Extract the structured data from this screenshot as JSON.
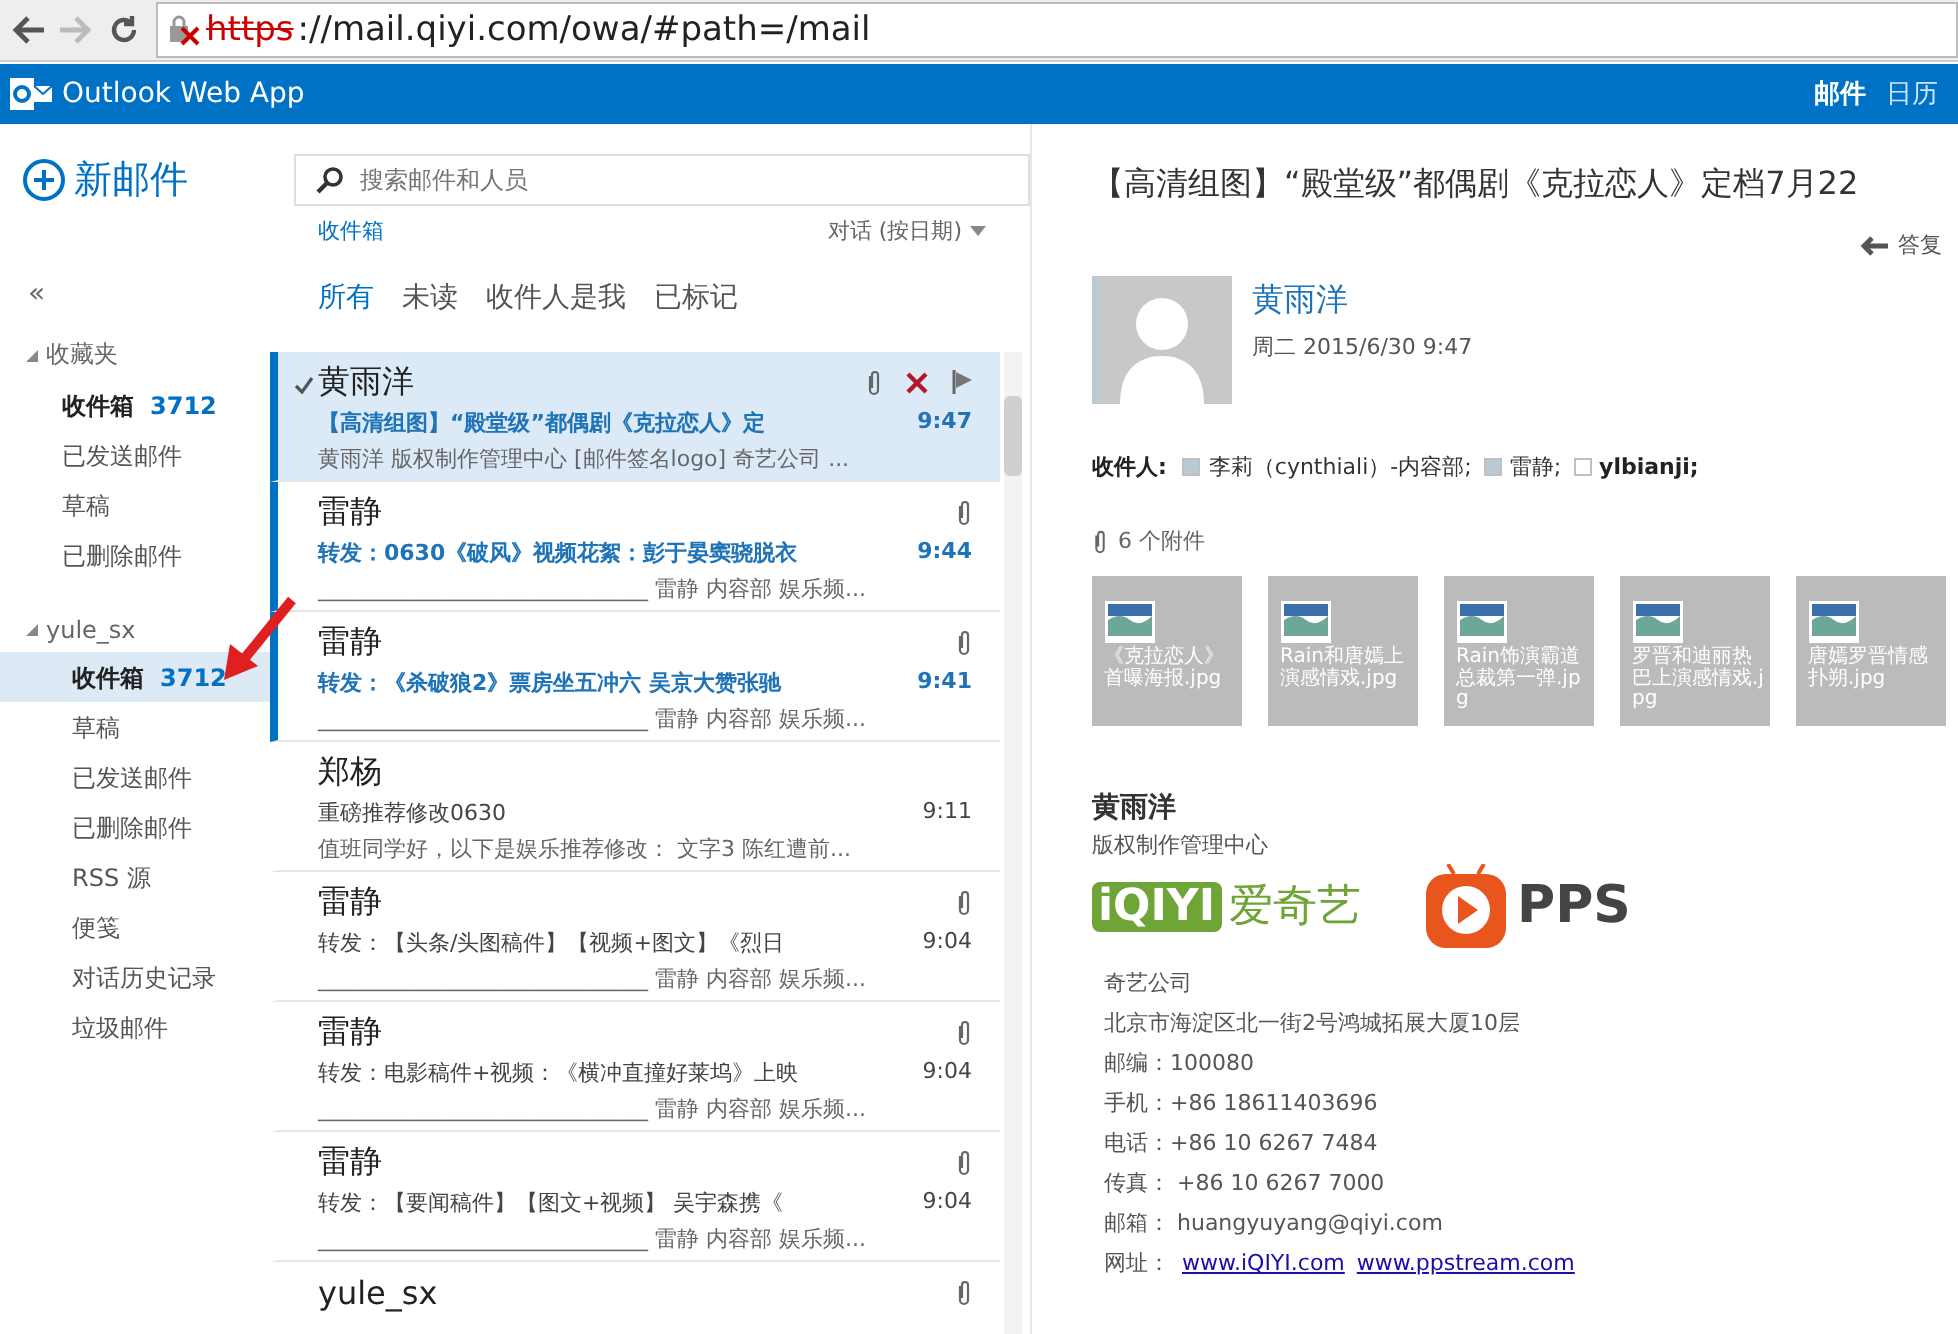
{
  "browser": {
    "url_scheme": "https",
    "url_rest": "://mail.qiyi.com/owa/#path=/mail"
  },
  "app_bar": {
    "title": "Outlook Web App",
    "nav": [
      {
        "label": "邮件",
        "selected": true
      },
      {
        "label": "日历",
        "selected": false
      }
    ]
  },
  "sidebar": {
    "new_mail": "新邮件",
    "collapse": "«",
    "groups": [
      {
        "name": "收藏夹",
        "expanded": true,
        "items": [
          {
            "label": "收件箱",
            "count": "3712",
            "selected": false
          },
          {
            "label": "已发送邮件",
            "selected": false
          },
          {
            "label": "草稿",
            "selected": false
          },
          {
            "label": "已删除邮件",
            "selected": false
          }
        ]
      },
      {
        "name": "yule_sx",
        "expanded": true,
        "items": [
          {
            "label": "收件箱",
            "count": "3712",
            "selected": true
          },
          {
            "label": "草稿",
            "selected": false
          },
          {
            "label": "已发送邮件",
            "selected": false
          },
          {
            "label": "已删除邮件",
            "selected": false
          },
          {
            "label": "RSS 源",
            "selected": false
          },
          {
            "label": "便笺",
            "selected": false
          },
          {
            "label": "对话历史记录",
            "selected": false
          },
          {
            "label": "垃圾邮件",
            "selected": false
          }
        ]
      }
    ]
  },
  "message_list": {
    "search_placeholder": "搜索邮件和人员",
    "folder": "收件箱",
    "sort": "对话 (按日期)",
    "filters": [
      {
        "label": "所有",
        "selected": true
      },
      {
        "label": "未读",
        "selected": false
      },
      {
        "label": "收件人是我",
        "selected": false
      },
      {
        "label": "已标记",
        "selected": false
      }
    ],
    "messages": [
      {
        "sender": "黄雨洋",
        "subject": "【高清组图】“殿堂级”都偶剧《克拉恋人》定",
        "preview": "黄雨洋 版权制作管理中心 [邮件签名logo] 奇艺公司 ...",
        "time": "9:47",
        "unread": true,
        "selected": true,
        "checked": true,
        "attachment": true
      },
      {
        "sender": "雷静",
        "subject": "转发：0630《破风》视频花絮：彭于晏窦骁脱衣",
        "preview": "______________________________ 雷静 内容部 娱乐频...",
        "time": "9:44",
        "unread": true,
        "selected": false,
        "checked": false,
        "attachment": true
      },
      {
        "sender": "雷静",
        "subject": "转发：《杀破狼2》票房坐五冲六 吴京大赞张驰",
        "preview": "______________________________ 雷静 内容部 娱乐频...",
        "time": "9:41",
        "unread": true,
        "selected": false,
        "checked": false,
        "attachment": true
      },
      {
        "sender": "郑杨",
        "subject": "重磅推荐修改0630",
        "preview": "值班同学好，以下是娱乐推荐修改： 文字3 陈红遭前...",
        "time": "9:11",
        "unread": false,
        "selected": false,
        "checked": false,
        "attachment": false
      },
      {
        "sender": "雷静",
        "subject": "转发：【头条/头图稿件】【视频+图文】《烈日",
        "preview": "______________________________ 雷静 内容部 娱乐频...",
        "time": "9:04",
        "unread": false,
        "selected": false,
        "checked": false,
        "attachment": true
      },
      {
        "sender": "雷静",
        "subject": "转发：电影稿件+视频：《横冲直撞好莱坞》上映",
        "preview": "______________________________ 雷静 内容部 娱乐频...",
        "time": "9:04",
        "unread": false,
        "selected": false,
        "checked": false,
        "attachment": true
      },
      {
        "sender": "雷静",
        "subject": "转发：【要闻稿件】【图文+视频】 吴宇森携《",
        "preview": "______________________________ 雷静 内容部 娱乐频...",
        "time": "9:04",
        "unread": false,
        "selected": false,
        "checked": false,
        "attachment": true
      },
      {
        "sender": "yule_sx",
        "unread": false,
        "selected": false,
        "checked": false,
        "attachment": true
      }
    ]
  },
  "reading_pane": {
    "subject": "【高清组图】“殿堂级”都偶剧《克拉恋人》定档7月22",
    "reply": "答复",
    "sender": "黄雨洋",
    "date": "周二 2015/6/30 9:47",
    "to_label": "收件人:",
    "recipients": [
      {
        "name": "李莉（cynthiali）-内容部;",
        "kind": "person",
        "color": "#b8cad3"
      },
      {
        "name": "雷静;",
        "kind": "person",
        "color": "#b8cad3"
      },
      {
        "name": "ylbianji;",
        "kind": "list",
        "color": "#ffffff"
      }
    ],
    "attachments_label": "6 个附件",
    "attachments": [
      "《克拉恋人》首曝海报.jpg",
      "Rain和唐嫣上演感情戏.jpg",
      "Rain饰演霸道总裁第一弹.jpg",
      "罗晋和迪丽热巴上演感情戏.jpg",
      "唐嫣罗晋情感扑朔.jpg"
    ],
    "signature": {
      "name": "黄雨洋",
      "department": "版权制作管理中心",
      "logo_left_mark": "iQIYI",
      "logo_left_name": "爱奇艺",
      "logo_right": "PPS",
      "lines": [
        "奇艺公司",
        "北京市海淀区北一街2号鸿城拓展大厦10层",
        "邮编：100080",
        "手机：+86 18611403696",
        "电话：+86 10 6267 7484",
        "传真： +86 10 6267 7000",
        "邮箱： huangyuyang@qiyi.com"
      ],
      "web_label": "网址：",
      "links": [
        "www.iQIYI.com",
        "www.ppstream.com"
      ]
    }
  }
}
